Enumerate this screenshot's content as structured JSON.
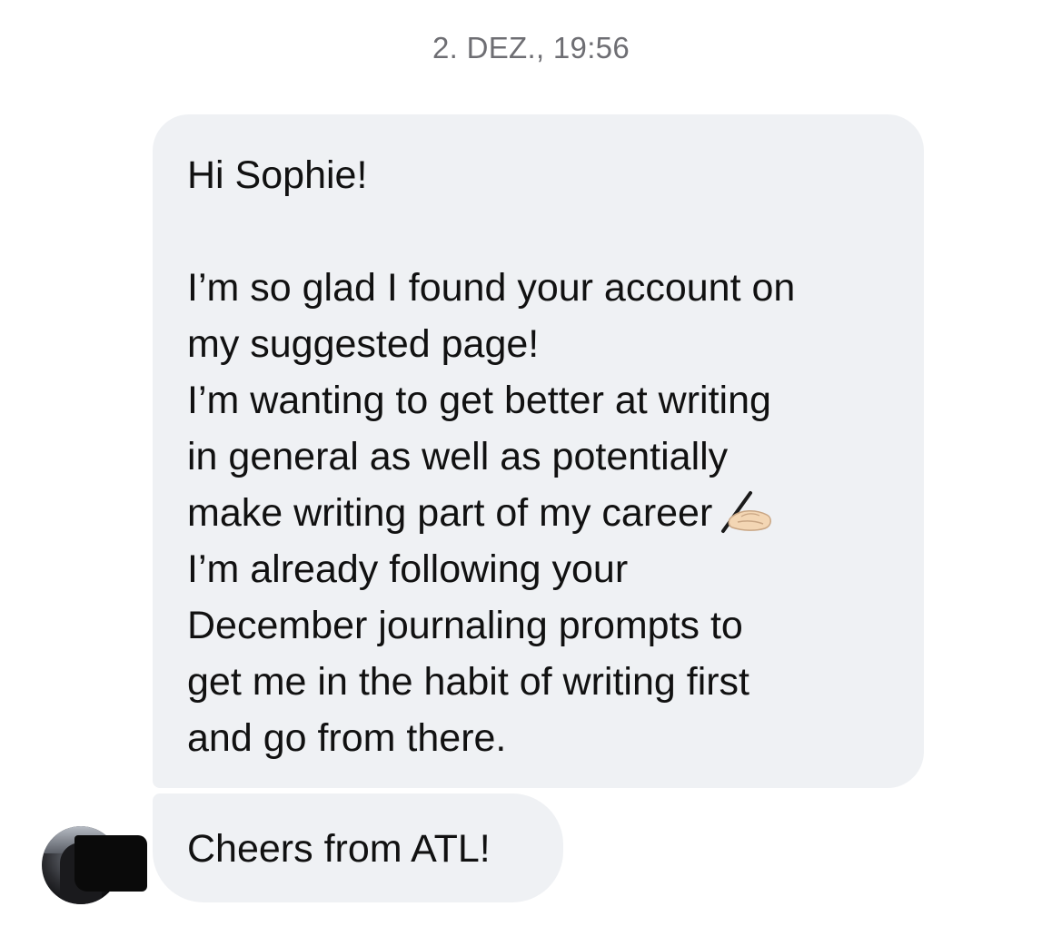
{
  "conversation": {
    "timestamp": "2. DEZ., 19:56",
    "message_main": {
      "greeting": "Hi Sophie!",
      "lines": [
        "I’m so glad I found your account on",
        "my suggested page!",
        "I’m wanting to get better at writing",
        "in general as well as potentially",
        "make writing part of my career",
        "I’m already following your",
        "December journaling prompts to",
        "get me in the habit of writing first",
        "and go from there."
      ],
      "emoji": "writing-hand-emoji"
    },
    "message_last": {
      "text": "Cheers from ATL!"
    },
    "sender": {
      "avatar": "profile-photo",
      "name_redacted": true
    }
  }
}
